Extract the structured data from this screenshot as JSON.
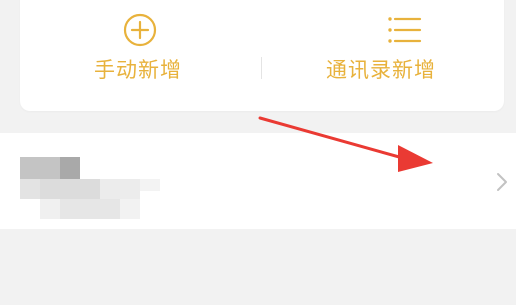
{
  "quick_add": {
    "manual": {
      "label": "手动新增",
      "icon": "plus-circle-icon"
    },
    "contacts": {
      "label": "通讯录新增",
      "icon": "list-icon"
    }
  },
  "contact_row": {
    "icon": "chevron-right-icon"
  },
  "colors": {
    "accent": "#e8b23c",
    "card_bg": "#ffffff",
    "page_bg": "#f2f2f2",
    "annotation_arrow": "#ea3a33",
    "chevron": "#c2c2c2"
  }
}
